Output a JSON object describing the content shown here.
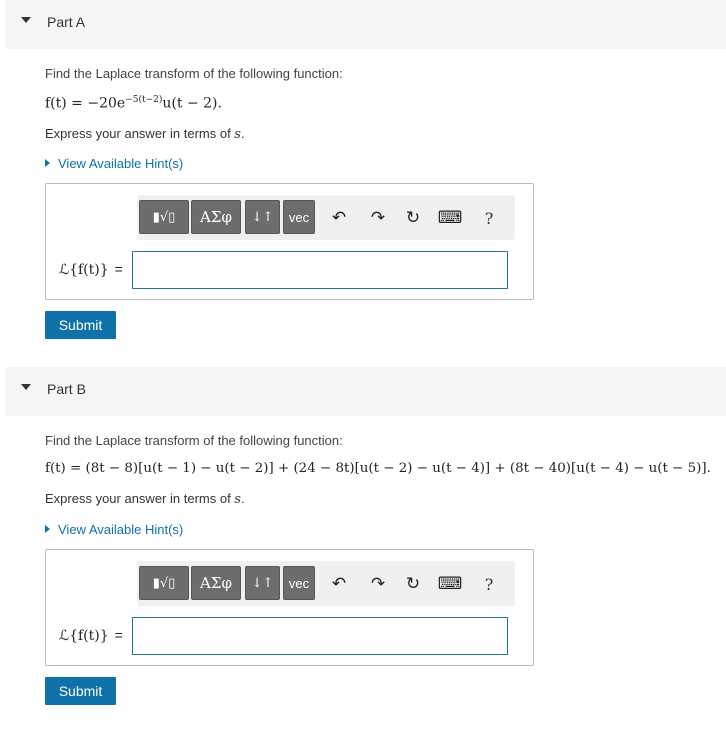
{
  "parts": [
    {
      "title": "Part A",
      "prompt": "Find the Laplace transform of the following function:",
      "function_text": "f(t) = −20e",
      "function_exp": "−5(t−2)",
      "function_tail": "u(t − 2).",
      "express_prefix": "Express your answer in terms of ",
      "express_var": "s",
      "express_suffix": ".",
      "hint": "View Available Hint(s)",
      "lhs": "ℒ{f(t)}",
      "eq": "=",
      "answer_value": "",
      "submit": "Submit"
    },
    {
      "title": "Part B",
      "prompt": "Find the Laplace transform of the following function:",
      "function_text": "f(t) = (8t − 8)[u(t − 1) − u(t − 2)] + (24 − 8t)[u(t − 2) − u(t − 4)] + (8t − 40)[u(t − 4) − u(t − 5)].",
      "express_prefix": "Express your answer in terms of ",
      "express_var": "s",
      "express_suffix": ".",
      "hint": "View Available Hint(s)",
      "lhs": "ℒ{f(t)}",
      "eq": "=",
      "answer_value": "",
      "submit": "Submit"
    }
  ],
  "toolbar": {
    "templates_icon": "▮√▯",
    "greek": "ΑΣφ",
    "arrows": "↓↑",
    "vec": "vec",
    "undo": "↶",
    "redo": "↷",
    "reset": "↻",
    "keyboard": "⌨",
    "help": "?"
  }
}
